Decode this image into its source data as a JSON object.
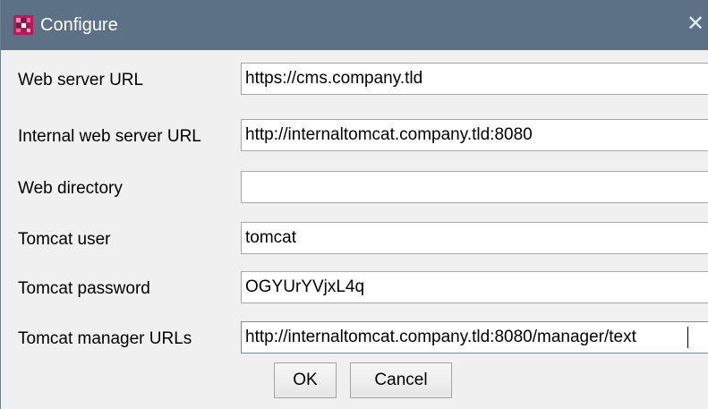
{
  "window": {
    "title": "Configure",
    "close_glyph": "✕",
    "app_icon": "app-logo-icon",
    "titlebar_color": "#5d7186"
  },
  "form": {
    "web_server_url": {
      "label": "Web server URL",
      "value": "https://cms.company.tld"
    },
    "internal_web_server_url": {
      "label": "Internal web server URL",
      "value": "http://internaltomcat.company.tld:8080"
    },
    "web_directory": {
      "label": "Web directory",
      "value": ""
    },
    "tomcat_user": {
      "label": "Tomcat user",
      "value": "tomcat"
    },
    "tomcat_password": {
      "label": "Tomcat password",
      "value": "OGYUrYVjxL4q"
    },
    "tomcat_manager_urls": {
      "label": "Tomcat manager URLs",
      "value": "http://internaltomcat.company.tld:8080/manager/text"
    }
  },
  "buttons": {
    "ok": "OK",
    "cancel": "Cancel"
  }
}
